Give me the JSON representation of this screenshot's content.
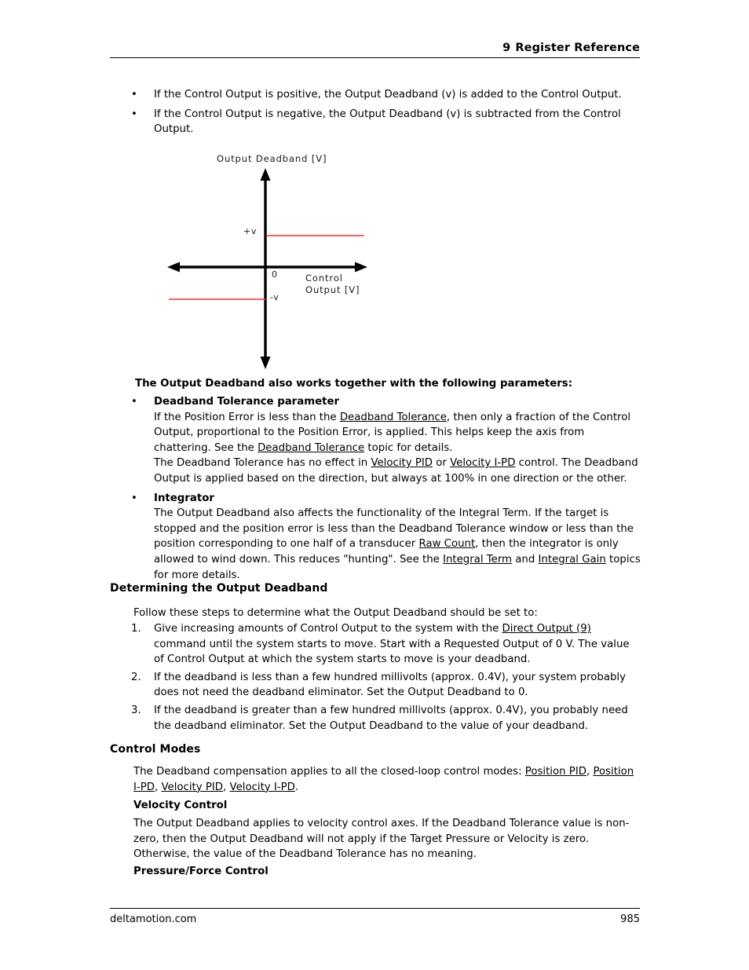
{
  "header": {
    "chapter_number": "9",
    "title": "Register Reference"
  },
  "footer": {
    "site": "deltamotion.com",
    "page_number": "985"
  },
  "intro_bullets": [
    "If the Control Output is positive, the Output Deadband (v) is added to the Control Output.",
    "If the Control Output is negative, the Output Deadband (v) is subtracted from the Control Output."
  ],
  "diagram": {
    "y_axis_title": "Output Deadband [V]",
    "x_axis_title_line1": "Control",
    "x_axis_title_line2": "Output [V]",
    "tick_positive": "+v",
    "tick_origin": "0",
    "tick_negative": "-v",
    "series_color": "#FF2B2B",
    "axis_color": "#000000"
  },
  "parameters_section": {
    "lead_in": "The Output Deadband also works together with the following parameters:",
    "items": [
      {
        "title": "Deadband Tolerance parameter",
        "paragraphs": [
          {
            "runs": [
              {
                "t": "If the Position Error is less than the "
              },
              {
                "t": "Deadband Tolerance",
                "link": true
              },
              {
                "t": ", then only a fraction of the Control Output, proportional to the Position Error, is applied. This helps keep the axis from chattering. See the "
              },
              {
                "t": "Deadband Tolerance",
                "link": true
              },
              {
                "t": " topic for details."
              }
            ]
          },
          {
            "runs": [
              {
                "t": "The Deadband Tolerance has no effect in "
              },
              {
                "t": "Velocity PID",
                "link": true
              },
              {
                "t": " or "
              },
              {
                "t": "Velocity I-PD",
                "link": true
              },
              {
                "t": " control. The Deadband Output is applied based on the direction, but always at 100% in one direction or the other."
              }
            ]
          }
        ]
      },
      {
        "title": "Integrator",
        "paragraphs": [
          {
            "runs": [
              {
                "t": "The Output Deadband also affects the functionality of the Integral Term. If the target is stopped and the position error is less than the Deadband Tolerance window or less than the position corresponding to one half of a transducer "
              },
              {
                "t": "Raw Count",
                "link": true
              },
              {
                "t": ", then the integrator is only allowed to wind down. This reduces \"hunting\". See the "
              },
              {
                "t": "Integral Term",
                "link": true
              },
              {
                "t": " and "
              },
              {
                "t": "Integral Gain",
                "link": true
              },
              {
                "t": " topics for more details."
              }
            ]
          }
        ]
      }
    ]
  },
  "determining_section": {
    "heading": "Determining the Output Deadband",
    "intro": "Follow these steps to determine what the Output Deadband should be set to:",
    "steps": [
      {
        "number": "1.",
        "runs": [
          {
            "t": "Give increasing amounts of Control Output to the system with the "
          },
          {
            "t": "Direct Output (9)",
            "link": true
          },
          {
            "t": " command until the system starts to move. Start with a Requested Output of 0 V. The value of Control Output at which the system starts to move is your deadband."
          }
        ]
      },
      {
        "number": "2.",
        "runs": [
          {
            "t": "If the deadband is less than a few hundred millivolts (approx. 0.4V), your system probably does not need the deadband eliminator. Set the Output Deadband to 0."
          }
        ]
      },
      {
        "number": "3.",
        "runs": [
          {
            "t": "If the deadband is greater than a few hundred millivolts (approx. 0.4V),  you probably need the deadband eliminator. Set the Output Deadband to the value of your deadband."
          }
        ]
      }
    ]
  },
  "control_modes_section": {
    "heading": "Control Modes",
    "intro_runs": [
      {
        "t": "The Deadband compensation applies to all the closed-loop control modes: "
      },
      {
        "t": "Position PID",
        "link": true
      },
      {
        "t": ", "
      },
      {
        "t": "Position I-PD",
        "link": true
      },
      {
        "t": ", "
      },
      {
        "t": "Velocity PID",
        "link": true
      },
      {
        "t": ", "
      },
      {
        "t": "Velocity I-PD",
        "link": true
      },
      {
        "t": "."
      }
    ],
    "velocity_control": {
      "heading": "Velocity Control",
      "body": "The Output Deadband applies to velocity control axes. If the Deadband Tolerance value is non-zero, then the Output Deadband will not apply if the Target Pressure or Velocity is zero. Otherwise, the value of the Deadband Tolerance has no meaning."
    },
    "pressure_force_control": {
      "heading": "Pressure/Force Control"
    }
  }
}
